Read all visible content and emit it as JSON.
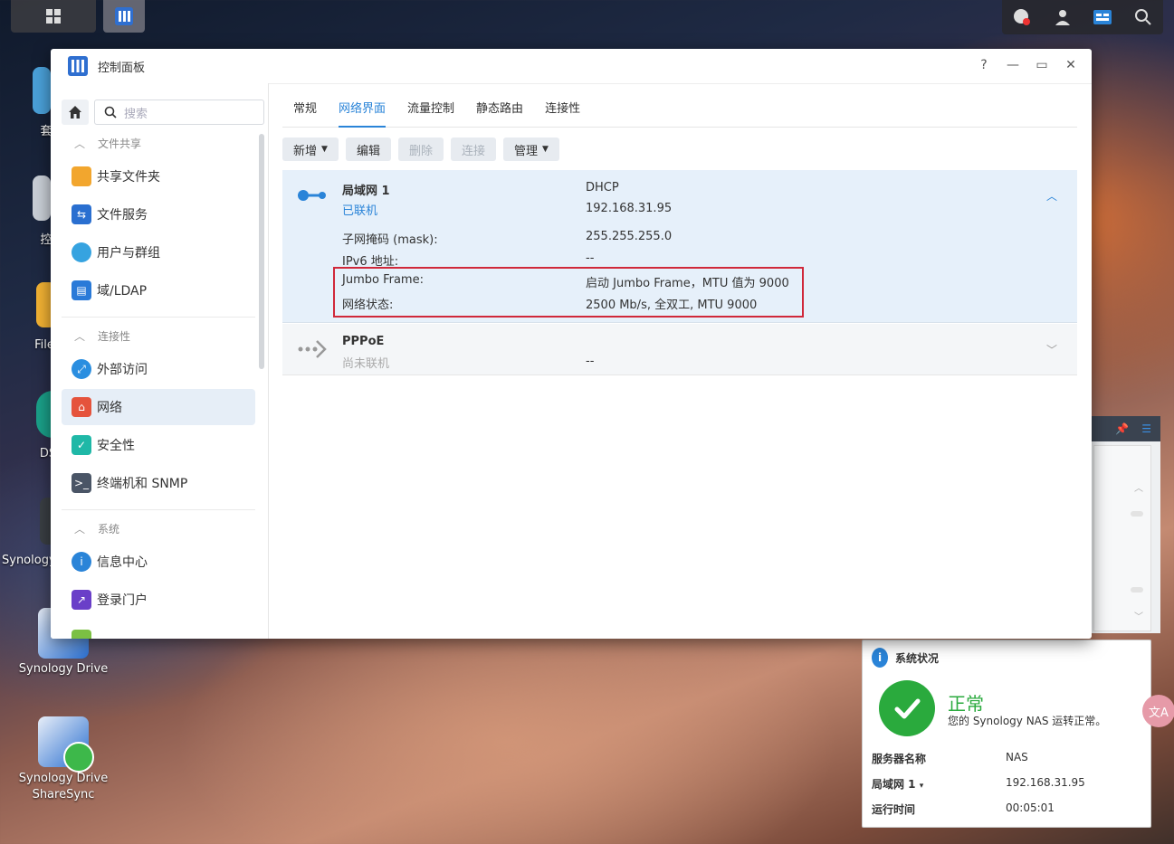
{
  "desktop": {
    "icons": [
      {
        "label": "套"
      },
      {
        "label": "控"
      },
      {
        "label": "File"
      },
      {
        "label": "DS"
      },
      {
        "label": "Synology"
      },
      {
        "label": "Synology Drive"
      },
      {
        "label": "Synology Drive ShareSync"
      }
    ]
  },
  "window": {
    "title": "控制面板",
    "help": "?",
    "minimize": "—",
    "maximize": "▭",
    "close": "✕"
  },
  "sidebar": {
    "search_placeholder": "搜索",
    "sections": [
      {
        "label": "文件共享"
      },
      {
        "label": "连接性"
      },
      {
        "label": "系统"
      }
    ],
    "items": [
      {
        "label": "共享文件夹",
        "icon": "folder-icon"
      },
      {
        "label": "文件服务",
        "icon": "file-services-icon"
      },
      {
        "label": "用户与群组",
        "icon": "users-icon"
      },
      {
        "label": "域/LDAP",
        "icon": "ldap-icon"
      },
      {
        "label": "外部访问",
        "icon": "external-access-icon"
      },
      {
        "label": "网络",
        "icon": "network-icon"
      },
      {
        "label": "安全性",
        "icon": "shield-icon"
      },
      {
        "label": "终端机和 SNMP",
        "icon": "terminal-icon"
      },
      {
        "label": "信息中心",
        "icon": "info-icon"
      },
      {
        "label": "登录门户",
        "icon": "login-portal-icon"
      }
    ]
  },
  "tabs": [
    "常规",
    "网络界面",
    "流量控制",
    "静态路由",
    "连接性"
  ],
  "toolbar": {
    "add": "新增",
    "edit": "编辑",
    "delete": "删除",
    "connect": "连接",
    "manage": "管理"
  },
  "interfaces": {
    "lan1": {
      "name": "局域网 1",
      "status": "已联机",
      "mode": "DHCP",
      "ip": "192.168.31.95",
      "rows": [
        {
          "label": "子网掩码 (mask):",
          "value": "255.255.255.0"
        },
        {
          "label": "IPv6 地址:",
          "value": "--"
        },
        {
          "label": "Jumbo Frame:",
          "value": "启动 Jumbo Frame，MTU 值为 9000"
        },
        {
          "label": "网络状态:",
          "value": "2500 Mb/s, 全双工, MTU 9000"
        }
      ]
    },
    "pppoe": {
      "name": "PPPoE",
      "status": "尚未联机",
      "value": "--"
    }
  },
  "system_widget": {
    "title": "系统状况",
    "status": "正常",
    "message": "您的 Synology NAS 运转正常。",
    "rows": [
      {
        "label": "服务器名称",
        "value": "NAS"
      },
      {
        "label": "局域网 1",
        "value": "192.168.31.95"
      },
      {
        "label": "运行时间",
        "value": "00:05:01"
      }
    ]
  },
  "colors": {
    "accent": "#2a84d8",
    "ok_green": "#2aaa3d",
    "highlight_red": "#d0283a"
  }
}
